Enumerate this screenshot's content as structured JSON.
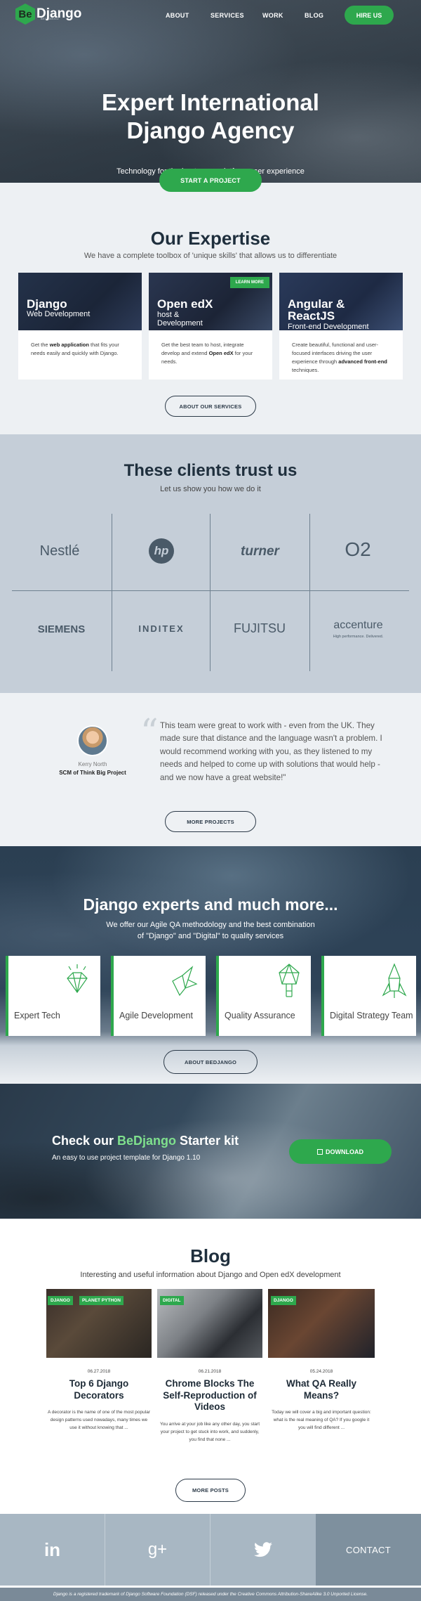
{
  "brand": {
    "logo_mark": "Be",
    "logo_text": "Django",
    "logo_sub": "BEDJANGO",
    "accent": "#2ea84d"
  },
  "nav": {
    "items": [
      "ABOUT",
      "SERVICES",
      "WORK",
      "BLOG"
    ],
    "cta": "HIRE US"
  },
  "hero": {
    "title_line1": "Expert International",
    "title_line2": "Django Agency",
    "subtitle": "Technology for the best cross-platform user experience",
    "cta": "START A PROJECT"
  },
  "expertise": {
    "title": "Our Expertise",
    "subtitle": "We have a complete toolbox of 'unique skills' that allows us to differentiate",
    "cards": [
      {
        "title": "Django",
        "subtitle": "Web Development",
        "text_pre": "Get the ",
        "text_bold": "web application",
        "text_post": " that fits your needs easily and quickly with Django."
      },
      {
        "title": "Open edX",
        "subtitle": "host & Development",
        "badge": "LEARN MORE",
        "text_pre": "Get the best team to host, integrate develop and extend ",
        "text_bold": "Open edX",
        "text_post": " for your needs."
      },
      {
        "title": "Angular & ReactJS",
        "subtitle": "Front-end Development",
        "text_pre": "Create beautiful, functional and user-focused interfaces driving the user experience through ",
        "text_bold": "advanced front-end",
        "text_post": " techniques."
      }
    ],
    "button": "ABOUT OUR SERVICES"
  },
  "clients": {
    "title": "These clients trust us",
    "subtitle": "Let us show you how we do it",
    "logos": [
      "Nestlé",
      "hp",
      "turner",
      "O2",
      "SIEMENS",
      "INDITEX",
      "FUJITSU",
      "accenture"
    ],
    "accenture_tagline": "High performance. Delivered."
  },
  "testimonial": {
    "name": "Kerry North",
    "role": "SCM of Think Big Project",
    "quote": "This team were great to work with - even from the UK. They made sure that distance and the language wasn't a problem. I would recommend working with you, as they listened to my needs and helped to come up with solutions that would help - and we now have a great website!\"",
    "button": "MORE PROJECTS"
  },
  "experts": {
    "title": "Django experts and much more...",
    "subtitle_line1": "We offer our Agile QA methodology and the best combination",
    "subtitle_line2": "of \"Django\" and \"Digital\" to quality services",
    "features": [
      "Expert Tech",
      "Agile Development",
      "Quality Assurance",
      "Digital Strategy Team"
    ],
    "feature_icons": [
      "diamond-icon",
      "origami-bird-icon",
      "geometric-lamp-icon",
      "rocket-icon"
    ],
    "button": "ABOUT BEDJANGO"
  },
  "starter": {
    "title_pre": "Check our ",
    "title_brand": "BeDjango",
    "title_post": " Starter kit",
    "subtitle": "An easy to use project template for Django 1.10",
    "button": "DOWNLOAD"
  },
  "blog": {
    "title": "Blog",
    "subtitle": "Interesting and useful information about Django and Open edX development",
    "posts": [
      {
        "tags": [
          "DJANGO",
          "PLANET PYTHON"
        ],
        "date": "06.27.2018",
        "title": "Top 6 Django Decorators",
        "excerpt": "A decorator is the name of one of the most popular design patterns used nowadays, many times we use it without knowing that ..."
      },
      {
        "tags": [
          "DIGITAL"
        ],
        "date": "06.21.2018",
        "title": "Chrome Blocks The Self-Reproduction of Videos",
        "excerpt": "You arrive at your job like any other day, you start your project to get stuck into work, and suddenly, you find that none ..."
      },
      {
        "tags": [
          "DJANGO"
        ],
        "date": "05.24.2018",
        "title": "What QA Really Means?",
        "excerpt": "Today we will cover a big and important question: what is the real meaning of QA? If you google it you will find different ..."
      }
    ],
    "button": "MORE POSTS"
  },
  "footer": {
    "social": [
      "in",
      "g+",
      "twitter"
    ],
    "contact": "CONTACT",
    "note": "Django is a registered trademark of Django Software Foundation (DSF) released under the Creative Commons Attribution-ShareAlike 3.0 Unported License."
  }
}
